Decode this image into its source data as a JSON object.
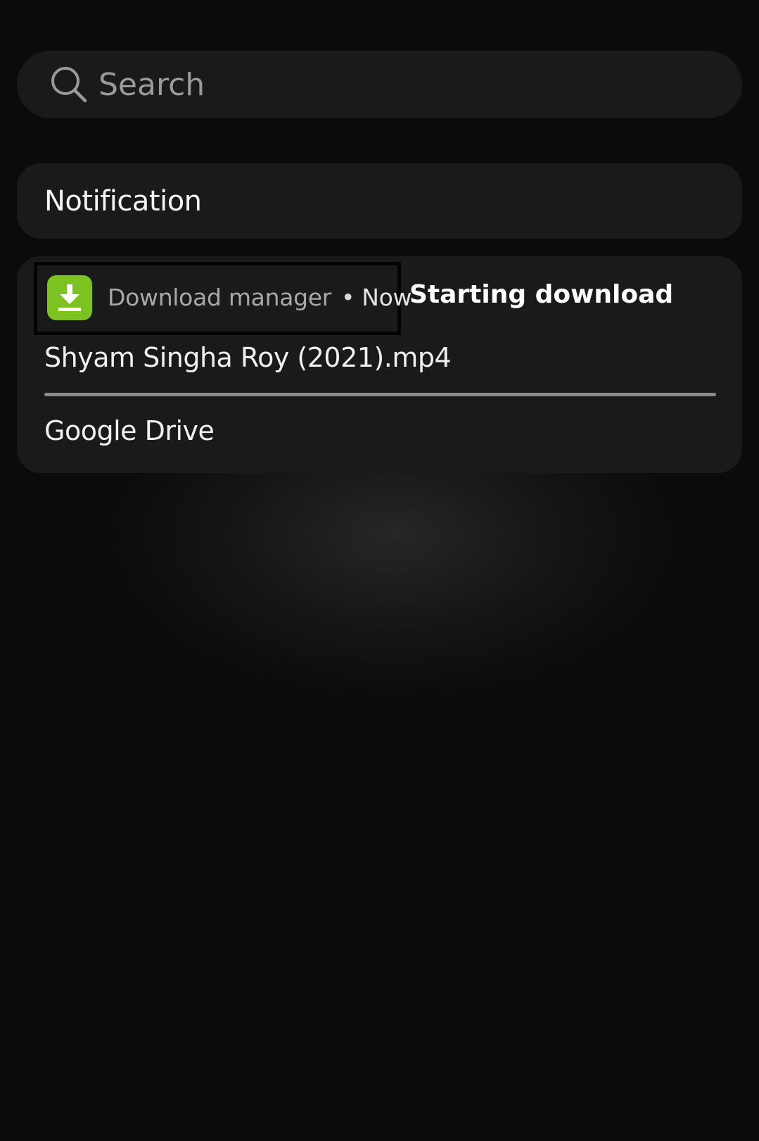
{
  "search": {
    "placeholder": "Search",
    "icon": "search-icon"
  },
  "section": {
    "title": "Notification"
  },
  "notification": {
    "app_icon": "download-icon",
    "app_icon_color": "#7cc322",
    "app_name": "Download manager",
    "separator": "•",
    "time": "Now",
    "title": "Starting download",
    "text": "Shyam Singha Roy (2021).mp4",
    "progress_percent": 100,
    "source": "Google Drive"
  }
}
